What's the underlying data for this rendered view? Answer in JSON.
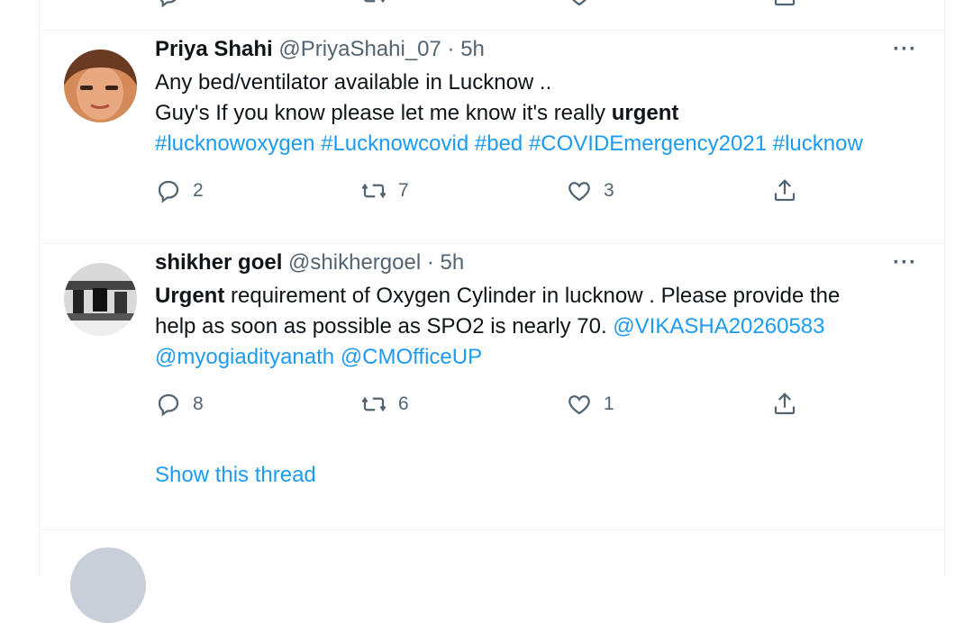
{
  "tweets": [
    {
      "name": "Priya Shahi",
      "handle": "@PriyaShahi_07",
      "time": "· 5h",
      "more": "···",
      "line1": "Any bed/ventilator available in Lucknow ..",
      "line2_text": "Guy's If you know please let me know it's really ",
      "line2_bold": "urgent",
      "hashtags": "#lucknowoxygen #Lucknowcovid #bed #COVIDEmergency2021 #lucknow",
      "replies": "2",
      "retweets": "7",
      "likes": "3"
    },
    {
      "name": "shikher goel",
      "handle": "@shikhergoel",
      "time": "· 5h",
      "more": "···",
      "line1_bold": "Urgent",
      "line1_text": " requirement of Oxygen Cylinder in lucknow . Please provide the",
      "line2_text": "help as soon as possible as SPO2 is nearly 70. ",
      "line2_mention": "@VIKASHA20260583",
      "line3_mention1": "@myogiadityanath",
      "line3_mention2": "@CMOfficeUP",
      "replies": "8",
      "retweets": "6",
      "likes": "1",
      "show_thread": "Show this thread"
    }
  ],
  "colors": {
    "link": "#1d9bf0",
    "muted": "#536471",
    "divider": "#eff3f4"
  },
  "icons": [
    "reply-icon",
    "retweet-icon",
    "like-icon",
    "share-icon",
    "more-icon"
  ]
}
